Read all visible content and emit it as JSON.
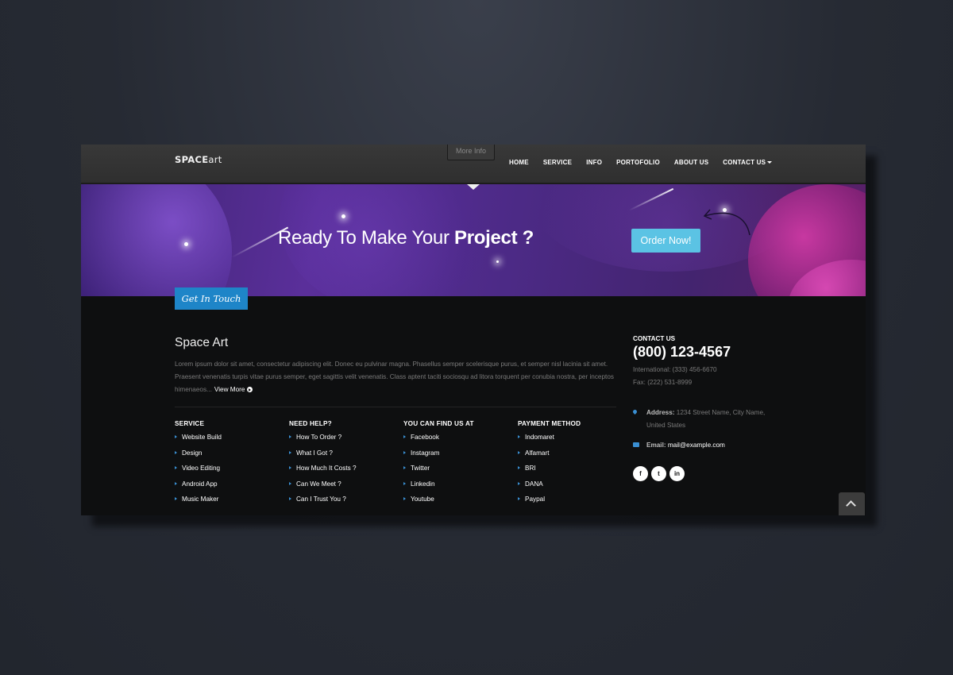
{
  "header": {
    "logo_bold": "SPACE",
    "logo_rest": "art",
    "more_info": "More Info",
    "nav": [
      "HOME",
      "SERVICE",
      "INFO",
      "PORTOFOLIO",
      "ABOUT US",
      "CONTACT US"
    ]
  },
  "banner": {
    "title_regular": "Ready To Make Your ",
    "title_bold": "Project ?",
    "order_button": "Order Now!",
    "get_in_touch": "Get In Touch"
  },
  "about": {
    "title": "Space Art",
    "text": "Lorem ipsum dolor sit amet, consectetur adipiscing elit. Donec eu pulvinar magna. Phasellus semper scelerisque purus, et semper nisl lacinia sit amet. Praesent venenatis turpis vitae purus semper, eget sagittis velit venenatis. Class aptent taciti sociosqu ad litora torquent per conubia nostra, per inceptos himenaeos...",
    "view_more": "View More"
  },
  "columns": [
    {
      "title": "SERVICE",
      "items": [
        "Website Build",
        "Design",
        "Video Editing",
        "Android App",
        "Music Maker"
      ]
    },
    {
      "title": "NEED HELP?",
      "items": [
        "How To Order ?",
        "What I Got ?",
        "How Much It Costs ?",
        "Can We Meet ?",
        "Can I Trust You ?"
      ]
    },
    {
      "title": "YOU CAN FIND US AT",
      "items": [
        "Facebook",
        "Instagram",
        "Twitter",
        "Linkedin",
        "Youtube"
      ]
    },
    {
      "title": "PAYMENT METHOD",
      "items": [
        "Indomaret",
        "Alfamart",
        "BRI",
        "DANA",
        "Paypal"
      ]
    }
  ],
  "contact": {
    "label": "CONTACT US",
    "phone": "(800) 123-4567",
    "international": "International: (333) 456-6670",
    "fax": "Fax: (222) 531-8999",
    "address_label": "Address:",
    "address_line1": "1234 Street Name, City Name,",
    "address_line2": "United States",
    "email_label": "Email:",
    "email": "mail@example.com",
    "socials": [
      "f",
      "t",
      "in"
    ]
  },
  "colors": {
    "accent_blue": "#1e85c8",
    "order_button": "#5bc3e4",
    "banner_purple": "#4c2a86"
  }
}
